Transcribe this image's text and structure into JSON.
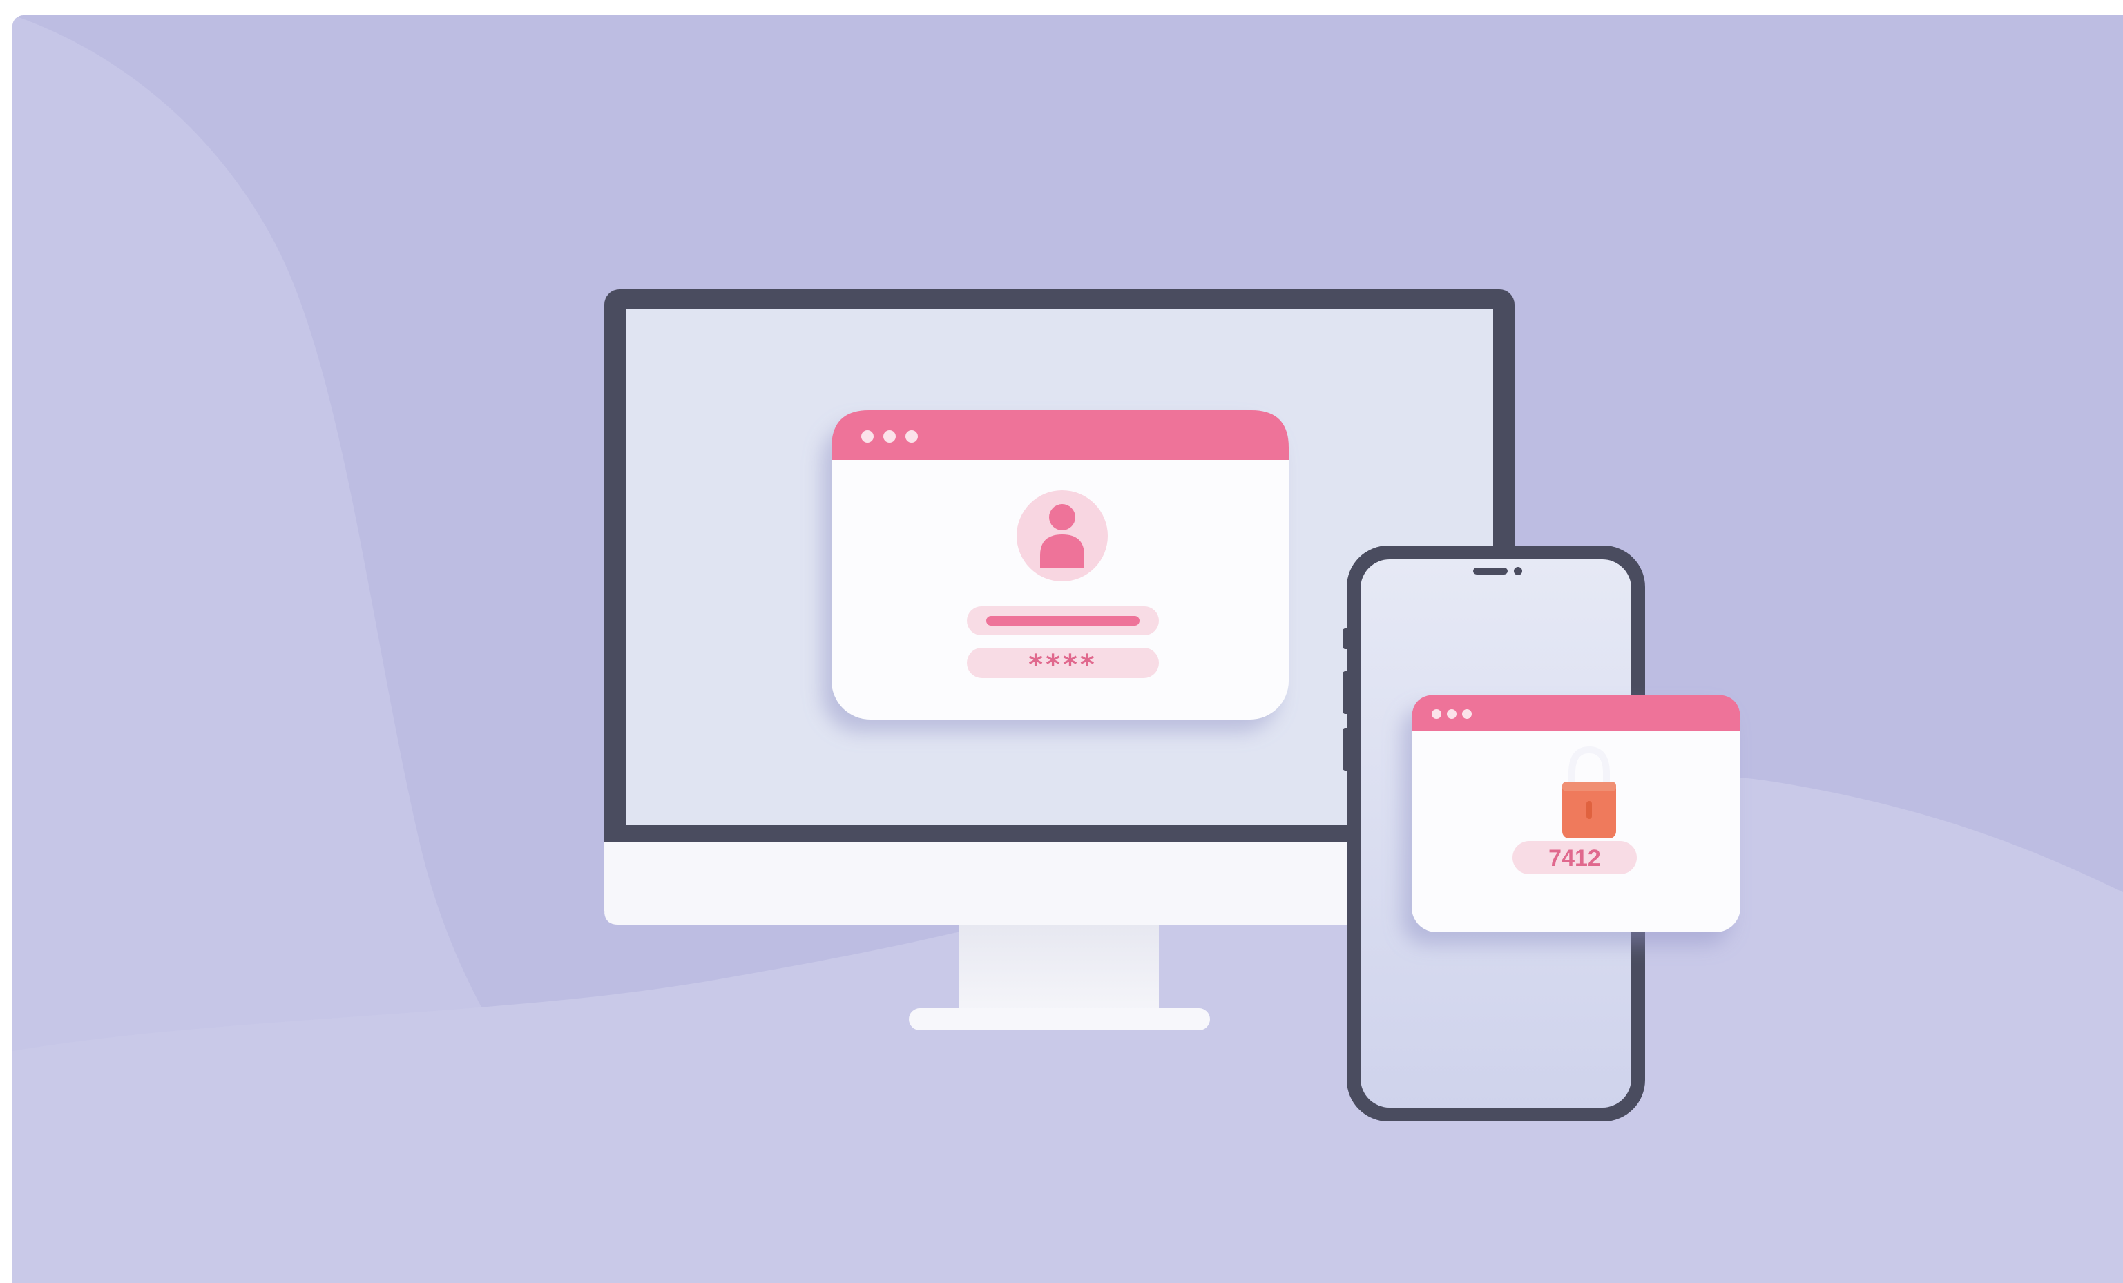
{
  "scene": {
    "description_icon_names": [
      "desktop-monitor",
      "smartphone",
      "login-window",
      "user-icon",
      "padlock-icon"
    ],
    "colors": {
      "background": "#bdbde2",
      "frame": "#4a4c5f",
      "screen": "#e0e4f2",
      "accent": "#ee7399",
      "accent_soft": "#f8dce5",
      "lock": "#ef7a5c"
    }
  },
  "login_window": {
    "password_mask": "****"
  },
  "otp_window": {
    "code": "7412"
  }
}
